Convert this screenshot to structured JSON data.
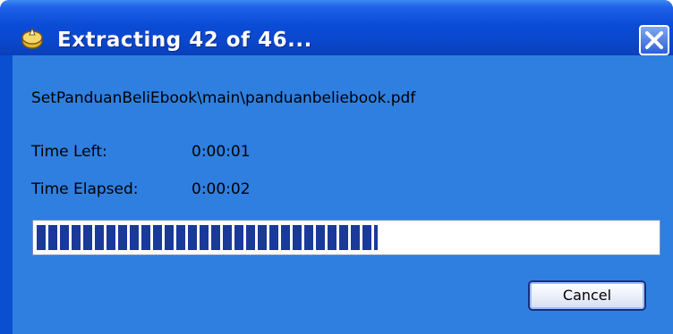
{
  "window": {
    "title": "Extracting 42 of 46...",
    "close_icon": "close-icon",
    "app_icon": "extract-app-icon"
  },
  "content": {
    "file_path": "SetPanduanBeliEbook\\main\\panduanbeliebook.pdf",
    "time_left_label": "Time Left:",
    "time_left_value": "0:00:01",
    "time_elapsed_label": "Time Elapsed:",
    "time_elapsed_value": "0:00:02",
    "progress_fraction": 0.55
  },
  "buttons": {
    "cancel_label": "Cancel"
  },
  "colors": {
    "title_bar": "#0a4fd0",
    "client_bg": "#2f7fe0",
    "progress_fill": "#1a3a9a"
  }
}
